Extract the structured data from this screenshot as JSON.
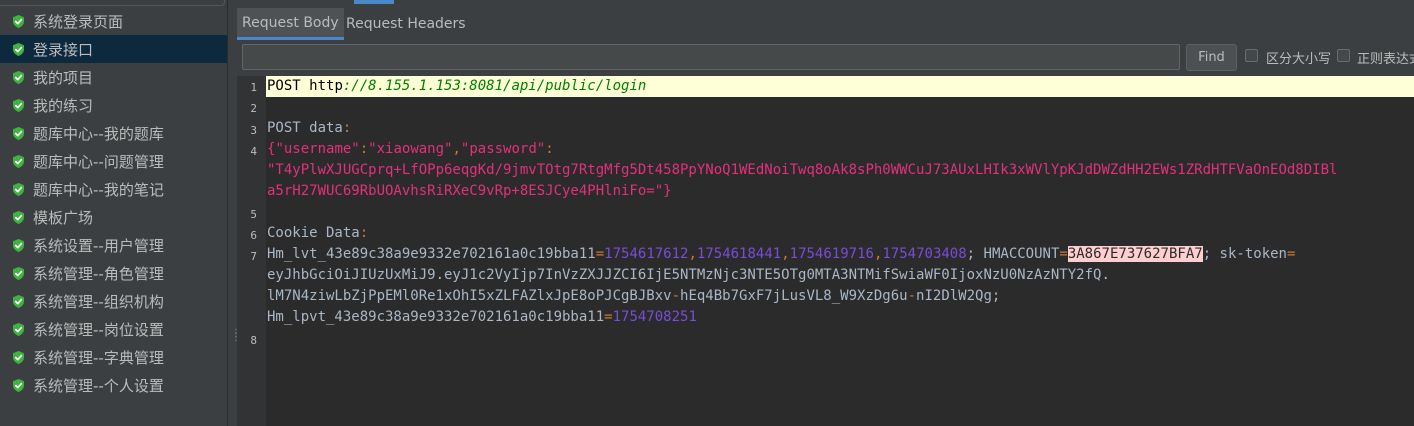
{
  "sidebar": {
    "items": [
      {
        "label": "系统登录页面",
        "selected": false
      },
      {
        "label": "登录接口",
        "selected": true
      },
      {
        "label": "我的项目",
        "selected": false
      },
      {
        "label": "我的练习",
        "selected": false
      },
      {
        "label": "题库中心--我的题库",
        "selected": false
      },
      {
        "label": "题库中心--问题管理",
        "selected": false
      },
      {
        "label": "题库中心--我的笔记",
        "selected": false
      },
      {
        "label": "模板广场",
        "selected": false
      },
      {
        "label": "系统设置--用户管理",
        "selected": false
      },
      {
        "label": "系统管理--角色管理",
        "selected": false
      },
      {
        "label": "系统管理--组织机构",
        "selected": false
      },
      {
        "label": "系统管理--岗位设置",
        "selected": false
      },
      {
        "label": "系统管理--字典管理",
        "selected": false
      },
      {
        "label": "系统管理--个人设置",
        "selected": false
      }
    ],
    "icon": "green-shield-check-icon",
    "icon_color": "#3fb33f"
  },
  "tabs": {
    "items": [
      {
        "label": "Request Body",
        "active": true
      },
      {
        "label": "Request Headers",
        "active": false
      }
    ],
    "accent": "#4a88c7"
  },
  "search": {
    "value": "",
    "placeholder": "",
    "find_label": "Find",
    "case_label": "区分大小写",
    "regex_label": "正则表达式"
  },
  "editor": {
    "line_numbers": [
      "1",
      "2",
      "3",
      "4",
      "5",
      "6",
      "7",
      "8"
    ],
    "line1_method": "POST ",
    "line1_url_scheme": "http",
    "line1_url_rest": "://8.155.1.153:8081/api/public/login",
    "post_data_label": "POST data",
    "post_data_colon": ":",
    "body_open": "{",
    "key_username": "\"username\"",
    "colon": ":",
    "val_username": "\"xiaowang\"",
    "comma": ",",
    "key_password": "\"password\"",
    "val_password_line1": "\"T4yPlwXJUGCprq+LfOPp6eqgKd/9jmvTOtg7RtgMfg5Dt458PpYNoQ1WEdNoiTwq8oAk8sPh0WWCuJ73AUxLHIk3xWVlYpKJdDWZdHH2EWs1ZRdHTFVaOnEOd8DIBl",
    "val_password_line2": "a5rH27WUC69RbUOAvhsRiRXeC9vRp+8ESJCye4PHlniFo=\"",
    "body_close": "}",
    "cookie_label": "Cookie Data",
    "cookie_hm_lvt_key": "Hm_lvt_43e89c38a9e9332e702161a0c19bba11",
    "cookie_eq": "=",
    "cookie_lvt_values": [
      "1754617612",
      "1754618441",
      "1754619716",
      "1754703408"
    ],
    "cookie_semi": "; ",
    "cookie_hmaccount_key": "HMACCOUNT",
    "cookie_hmaccount_val": "3A867E737627BFA7",
    "cookie_sk_token_key": "sk-token",
    "cookie_token_line1": "eyJhbGciOiJIUzUxMiJ9.eyJ1c2VyIjp7InVzZXJJZCI6IjE5NTMzNjc3NTE5OTg0MTA3NTMifSwiaWF0IjoxNzU0NzAzNTY2fQ.",
    "cookie_token_line2_a": "lM7N4ziwLbZjPpEMl0Re1xOhI5xZLFAZlxJpE8oPJCgBJBxv",
    "cookie_token_line2_b": "hEq4Bb7GxF7jLusVL8_W9XzDg6u",
    "cookie_token_line2_c": "nI2DlW2Qg;",
    "cookie_lpvt_key": "Hm_lpvt_43e89c38a9e9332e702161a0c19bba11",
    "cookie_lpvt_val": "1754708251",
    "colors": {
      "background": "#2b2b2b",
      "string": "#e2307c",
      "number": "#7a4cd8",
      "url": "#008000",
      "highlight_line": "#ffffd7",
      "match_highlight": "#ffcfcf"
    }
  }
}
